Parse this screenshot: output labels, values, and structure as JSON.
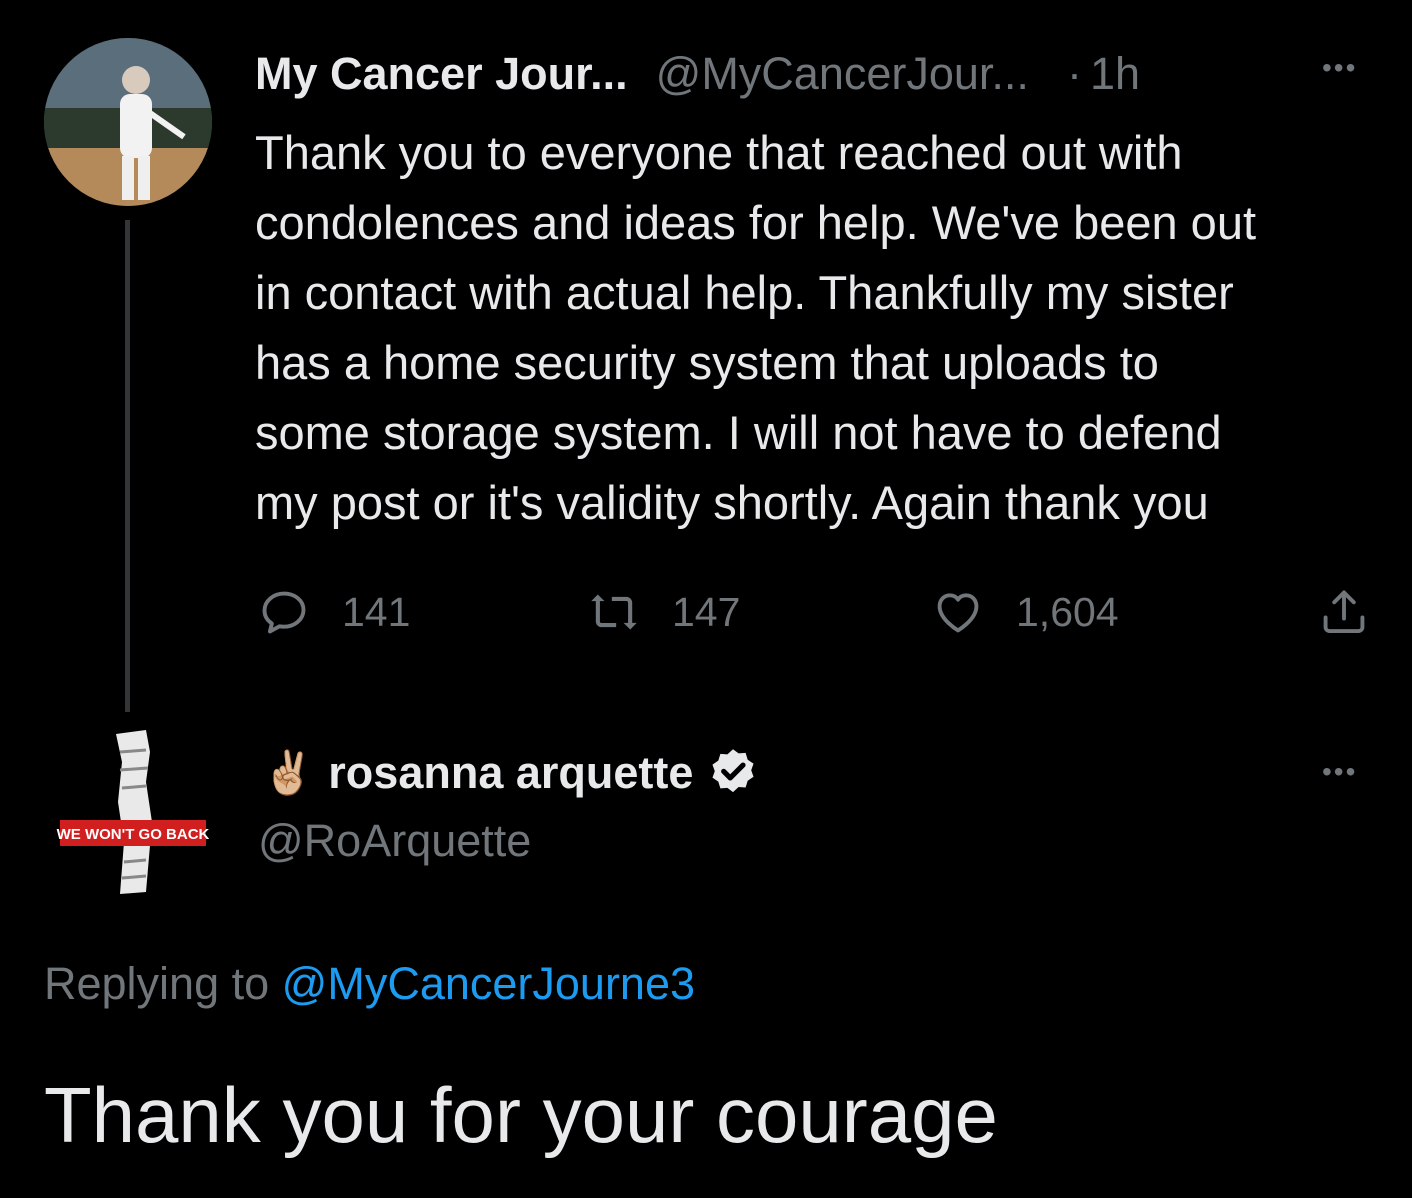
{
  "tweet": {
    "author_name": "My Cancer Jour...",
    "author_handle": "@MyCancerJour...",
    "dot": "·",
    "time": "1h",
    "more": "•••",
    "text": "Thank you to everyone that reached out with\ncondolences and ideas for help. We've been out\nin contact with actual help. Thankfully my sister\nhas a home security system that uploads to\nsome storage system. I will not have to defend\nmy post or it's validity shortly. Again thank you",
    "replies": "141",
    "retweets": "147",
    "likes": "1,604"
  },
  "reply": {
    "emoji": "✌🏼",
    "author_name": "rosanna arquette",
    "author_handle": "@RoArquette",
    "more": "•••",
    "avatar_text": "WE WON'T GO BACK",
    "replying_label": "Replying to",
    "replying_to": "@MyCancerJourne3",
    "text": "Thank you for your courage"
  },
  "colors": {
    "background": "#000000",
    "text": "#e7e9ea",
    "secondary": "#71767b",
    "link": "#1d9bf0"
  },
  "icons": [
    "reply-icon",
    "retweet-icon",
    "like-icon",
    "share-icon",
    "verified-badge-icon",
    "more-icon"
  ]
}
